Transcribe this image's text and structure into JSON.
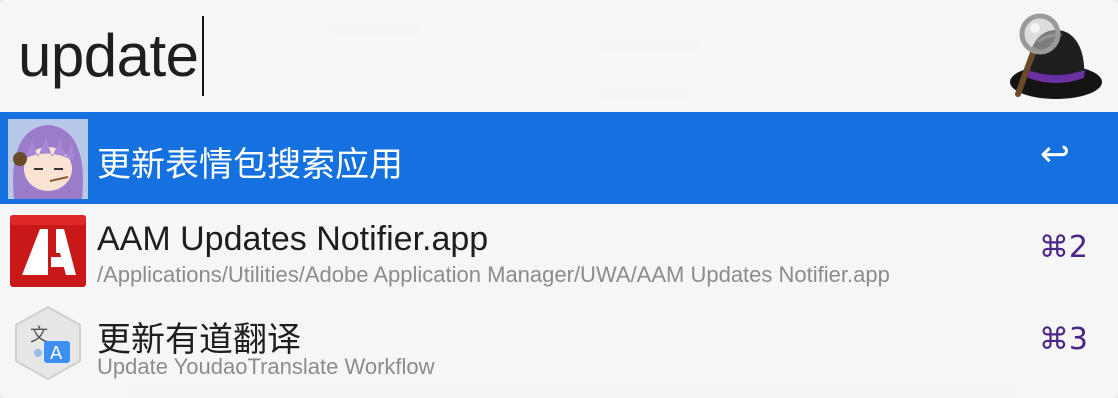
{
  "search": {
    "query": "update"
  },
  "app": {
    "logo_icon": "alfred-hat-icon"
  },
  "results": [
    {
      "title": "更新表情包搜索应用",
      "subtitle": "",
      "shortcut": "↩",
      "icon": "anime-avatar-icon",
      "selected": true
    },
    {
      "title": "AAM Updates Notifier.app",
      "subtitle": "/Applications/Utilities/Adobe Application Manager/UWA/AAM Updates Notifier.app",
      "shortcut": "⌘2",
      "icon": "adobe-icon",
      "selected": false
    },
    {
      "title": "更新有道翻译",
      "subtitle": "Update YoudaoTranslate Workflow",
      "shortcut": "⌘3",
      "icon": "translate-icon",
      "selected": false
    }
  ],
  "colors": {
    "selection": "#1570e0",
    "shortcut": "#4b2585",
    "adobe_red": "#d11a1a"
  }
}
